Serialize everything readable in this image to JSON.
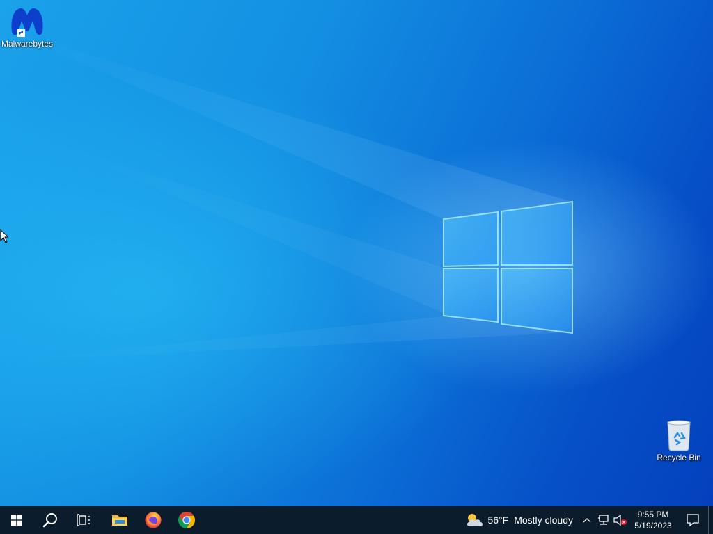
{
  "desktop": {
    "icons": [
      {
        "label": "Malwarebytes",
        "icon": "malwarebytes-icon"
      },
      {
        "label": "Recycle Bin",
        "icon": "recycle-bin-icon"
      }
    ]
  },
  "taskbar": {
    "buttons": [
      {
        "name": "start-button",
        "icon": "windows-logo-icon"
      },
      {
        "name": "search-button",
        "icon": "search-icon"
      },
      {
        "name": "task-view-button",
        "icon": "task-view-icon"
      },
      {
        "name": "file-explorer-button",
        "icon": "folder-icon"
      },
      {
        "name": "firefox-button",
        "icon": "firefox-icon"
      },
      {
        "name": "chrome-button",
        "icon": "chrome-icon"
      }
    ],
    "weather": {
      "temperature": "56°F",
      "condition": "Mostly cloudy",
      "icon": "partly-cloudy-icon"
    },
    "tray_icons": [
      "chevron-up-icon",
      "network-icon",
      "speaker-muted-icon"
    ],
    "clock": {
      "time": "9:55 PM",
      "date": "5/19/2023"
    },
    "action_center_icon": "notification-icon"
  },
  "colors": {
    "taskbar_bg": "#0b1c2c",
    "wallpaper_left": "#1aa2ea",
    "wallpaper_right": "#0440bd",
    "chrome_red": "#db4437",
    "chrome_yellow": "#f4b400",
    "chrome_green": "#0f9d58",
    "chrome_blue": "#4285f4",
    "firefox_orange": "#ff7139",
    "malwarebytes_blue": "#0d3ecc"
  }
}
